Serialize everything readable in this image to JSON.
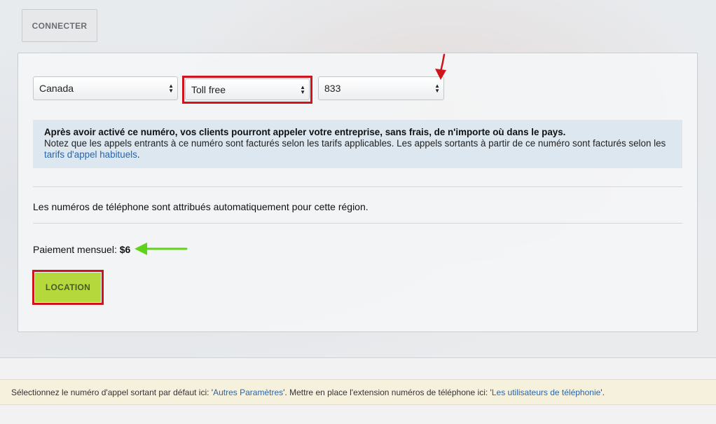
{
  "toolbar": {
    "connect_label": "CONNECTER"
  },
  "selectors": {
    "country": "Canada",
    "number_type": "Toll free",
    "prefix": "833"
  },
  "info": {
    "bold_line": "Après avoir activé ce numéro, vos clients pourront appeler votre entreprise, sans frais, de n'importe où dans le pays.",
    "line2_before": "Notez que les appels entrants à ce numéro sont facturés selon les tarifs applicables. Les appels sortants à partir de ce numéro sont facturés selon les ",
    "link": "tarifs d'appel habituels",
    "line2_after": "."
  },
  "auto_assign_text": "Les numéros de téléphone sont attribués automatiquement pour cette région.",
  "payment": {
    "label": "Paiement mensuel:",
    "value": "$6"
  },
  "rent_button": "LOCATION",
  "footer": {
    "part1": "Sélectionnez le numéro d'appel sortant par défaut ici: '",
    "link1": "Autres Paramètres",
    "part2": "'. Mettre en place l'extension numéros de téléphone ici: '",
    "link2": "Les utilisateurs de téléphonie",
    "part3": "'."
  },
  "colors": {
    "highlight_red": "#d0141b",
    "arrow_green": "#5fd31a",
    "link_blue": "#2a64a8",
    "rent_button_green": "#b5d93c"
  }
}
